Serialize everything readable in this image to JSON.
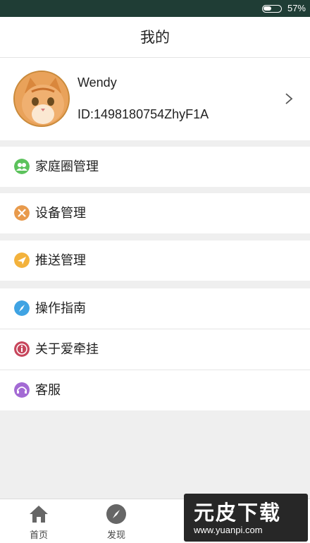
{
  "status_bar": {
    "battery_text": "57%"
  },
  "header": {
    "title": "我的"
  },
  "profile": {
    "username": "Wendy",
    "user_id": "ID:1498180754ZhyF1A"
  },
  "menu": [
    {
      "label": "家庭圈管理",
      "icon": "family-group-icon",
      "color": "#5cc25c"
    },
    {
      "label": "设备管理",
      "icon": "tools-icon",
      "color": "#e89a4c"
    },
    {
      "label": "推送管理",
      "icon": "paper-plane-icon",
      "color": "#f3b23c"
    },
    {
      "label": "操作指南",
      "icon": "compass-icon",
      "color": "#3fa3e3"
    },
    {
      "label": "关于爱牵挂",
      "icon": "info-icon",
      "color": "#c7465c"
    },
    {
      "label": "客服",
      "icon": "headset-icon",
      "color": "#a36ad4"
    }
  ],
  "bottom_nav": [
    {
      "label": "首页",
      "icon": "home-icon"
    },
    {
      "label": "发现",
      "icon": "compass-icon"
    }
  ],
  "watermark": {
    "title": "元皮下载",
    "url": "www.yuanpi.com"
  }
}
